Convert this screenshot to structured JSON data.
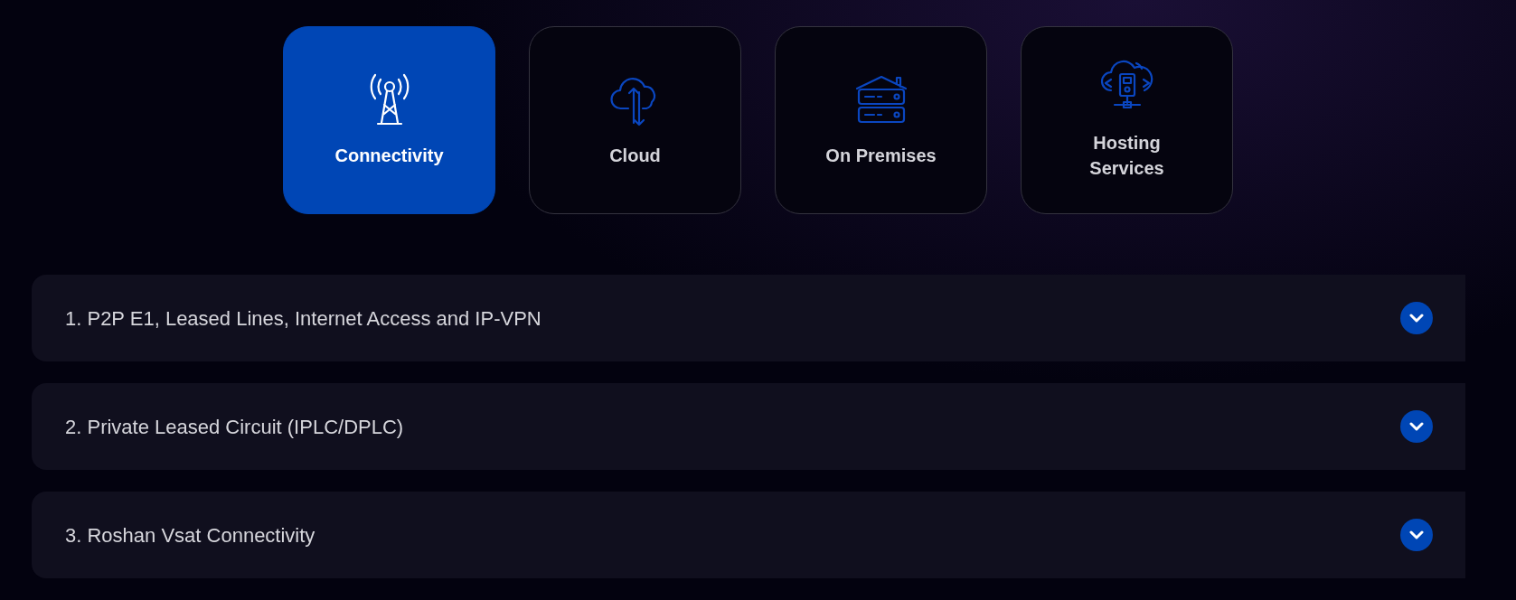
{
  "service_tabs": [
    {
      "label": "Connectivity",
      "kind": "tower",
      "selected": true
    },
    {
      "label": "Cloud",
      "kind": "cloud",
      "selected": false
    },
    {
      "label": "On Premises",
      "kind": "server",
      "selected": false
    },
    {
      "label": "Hosting Services",
      "kind": "hosting",
      "selected": false
    }
  ],
  "accordion": [
    {
      "title": "1. P2P E1, Leased Lines, Internet Access and IP-VPN",
      "expanded": false
    },
    {
      "title": "2. Private Leased Circuit (IPLC/DPLC)",
      "expanded": false
    },
    {
      "title": "3. Roshan Vsat Connectivity",
      "expanded": false
    }
  ]
}
